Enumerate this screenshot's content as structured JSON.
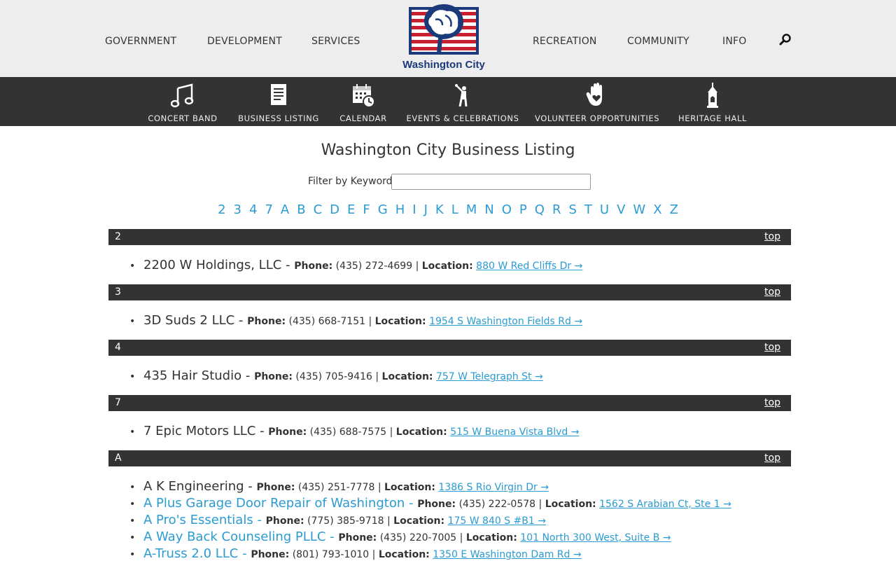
{
  "nav": {
    "left": [
      "GOVERNMENT",
      "DEVELOPMENT",
      "SERVICES"
    ],
    "right": [
      "RECREATION",
      "COMMUNITY",
      "INFO"
    ],
    "logo_text": "Washington City"
  },
  "quick_links": [
    {
      "label": "CONCERT BAND",
      "icon": "music-notes-icon"
    },
    {
      "label": "BUSINESS LISTING",
      "icon": "document-icon"
    },
    {
      "label": "CALENDAR",
      "icon": "calendar-clock-icon"
    },
    {
      "label": "EVENTS & CELEBRATIONS",
      "icon": "celebration-figure-icon"
    },
    {
      "label": "VOLUNTEER OPPORTUNITIES",
      "icon": "hand-heart-icon"
    },
    {
      "label": "HERITAGE HALL",
      "icon": "bell-tower-icon"
    }
  ],
  "page": {
    "title": "Washington City Business Listing",
    "filter_label": "Filter by Keyword:",
    "filter_value": ""
  },
  "letters": [
    "2",
    "3",
    "4",
    "7",
    "A",
    "B",
    "C",
    "D",
    "E",
    "F",
    "G",
    "H",
    "I",
    "J",
    "K",
    "L",
    "M",
    "N",
    "O",
    "P",
    "Q",
    "R",
    "S",
    "T",
    "U",
    "V",
    "W",
    "X",
    "Z"
  ],
  "labels": {
    "top": "top",
    "phone": "Phone:",
    "location": "Location:"
  },
  "sections": [
    {
      "letter": "2",
      "entries": [
        {
          "name": "2200 W Holdings, LLC",
          "phone": "(435) 272-4699",
          "location": "880 W Red Cliffs Dr →"
        }
      ]
    },
    {
      "letter": "3",
      "entries": [
        {
          "name": "3D Suds 2 LLC",
          "phone": "(435) 668-7151",
          "location": "1954 S Washington Fields Rd →"
        }
      ]
    },
    {
      "letter": "4",
      "entries": [
        {
          "name": "435 Hair Studio",
          "phone": "(435) 705-9416",
          "location": "757 W Telegraph St →"
        }
      ]
    },
    {
      "letter": "7",
      "entries": [
        {
          "name": "7 Epic Motors LLC",
          "phone": "(435) 688-7575",
          "location": "515 W Buena Vista Blvd →"
        }
      ]
    },
    {
      "letter": "A",
      "entries": [
        {
          "name": "A K Engineering",
          "phone": "(435) 251-7778",
          "location": "1386 S Rio Virgin Dr →"
        },
        {
          "name": "A Plus Garage Door Repair of Washington",
          "phone": "(435) 222-0578",
          "location": "1562 S Arabian Ct, Ste 1 →"
        },
        {
          "name": "A Pro's Essentials",
          "phone": "(775) 385-9718",
          "location": "175 W 840 S #B1 →"
        },
        {
          "name": "A Way Back Counseling PLLC",
          "phone": "(435) 220-7005",
          "location": "101 North 300 West, Suite B →"
        },
        {
          "name": "A-Truss 2.0 LLC",
          "phone": "(801) 793-1010",
          "location": "1350 E Washington Dam Rd →"
        }
      ]
    }
  ],
  "colors": {
    "accent": "#2b9bd3",
    "dark_bar": "#333333",
    "header_bg": "#ededed",
    "logo_blue": "#1b3a7a",
    "logo_red": "#c8202f"
  }
}
